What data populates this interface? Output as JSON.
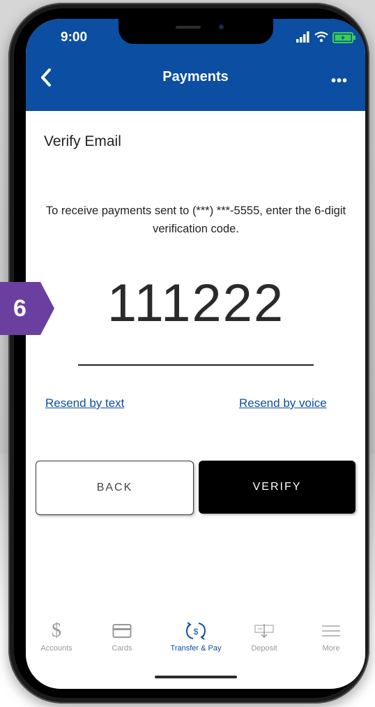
{
  "status": {
    "time": "9:00"
  },
  "header": {
    "title": "Payments"
  },
  "main": {
    "heading": "Verify Email",
    "instructions": "To receive payments sent to (***) ***-5555, enter the 6-digit verification code.",
    "code": "111222",
    "resend_text": "Resend by text",
    "resend_voice": "Resend by voice",
    "back_label": "BACK",
    "verify_label": "VERIFY"
  },
  "tabs": [
    {
      "label": "Accounts",
      "icon": "dollar-icon"
    },
    {
      "label": "Cards",
      "icon": "card-icon"
    },
    {
      "label": "Transfer & Pay",
      "icon": "transfer-pay-icon",
      "active": true
    },
    {
      "label": "Deposit",
      "icon": "deposit-icon"
    },
    {
      "label": "More",
      "icon": "menu-icon"
    }
  ],
  "callout": {
    "step": "6"
  },
  "colors": {
    "brand": "#0b4ea2",
    "callout": "#6b3fa0",
    "battery": "#3ccf4e"
  }
}
